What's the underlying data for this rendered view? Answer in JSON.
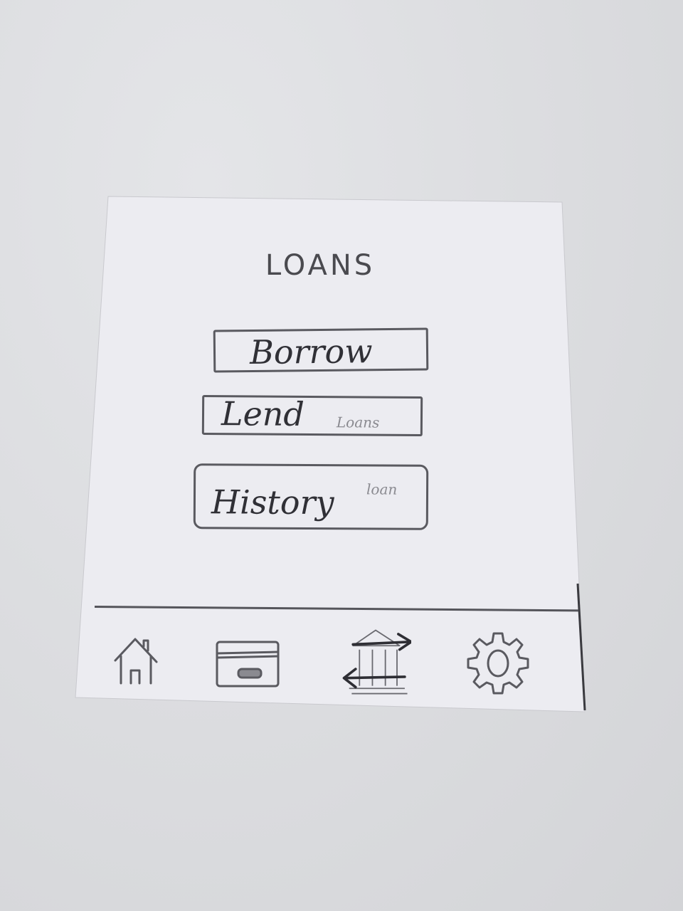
{
  "header": {
    "title": "LOANS"
  },
  "menu": {
    "borrow": {
      "label": "Borrow"
    },
    "lend": {
      "label": "Lend",
      "sub": "Loans"
    },
    "history": {
      "label": "History",
      "sub": "loan"
    }
  },
  "tabbar": {
    "items": [
      {
        "icon": "home-icon"
      },
      {
        "icon": "card-icon"
      },
      {
        "icon": "bank-transfer-icon"
      },
      {
        "icon": "gear-icon"
      }
    ]
  }
}
